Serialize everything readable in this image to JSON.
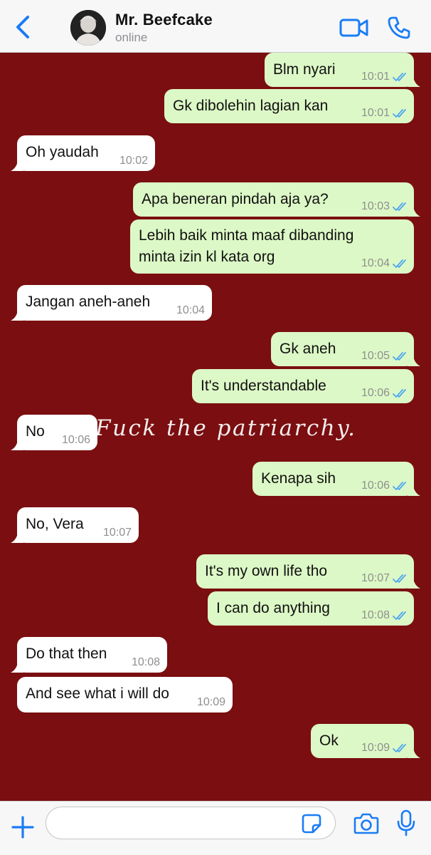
{
  "header": {
    "contact_name": "Mr. Beefcake",
    "status": "online"
  },
  "wallpaper_text": "Fuck the patriarchy.",
  "colors": {
    "accent": "#1a7cf5",
    "chat_background": "#7a0e10",
    "incoming_bubble": "#ffffff",
    "outgoing_bubble": "#dcf8c6",
    "read_ticks": "#4fa7f1"
  },
  "messages": [
    {
      "dir": "out",
      "text": "Blm nyari",
      "time": "10:01"
    },
    {
      "dir": "out",
      "text": "Gk dibolehin lagian kan",
      "time": "10:01"
    },
    {
      "dir": "in",
      "text": "Oh yaudah",
      "time": "10:02"
    },
    {
      "dir": "out",
      "text": "Apa beneran pindah aja ya?",
      "time": "10:03"
    },
    {
      "dir": "out",
      "text": "Lebih baik minta maaf dibanding minta izin kl kata org",
      "time": "10:04"
    },
    {
      "dir": "in",
      "text": "Jangan aneh-aneh",
      "time": "10:04"
    },
    {
      "dir": "out",
      "text": "Gk aneh",
      "time": "10:05"
    },
    {
      "dir": "out",
      "text": "It's understandable",
      "time": "10:06"
    },
    {
      "dir": "in",
      "text": "No",
      "time": "10:06"
    },
    {
      "dir": "out",
      "text": "Kenapa sih",
      "time": "10:06"
    },
    {
      "dir": "in",
      "text": "No, Vera",
      "time": "10:07"
    },
    {
      "dir": "out",
      "text": "It's my own life tho",
      "time": "10:07"
    },
    {
      "dir": "out",
      "text": "I can do anything",
      "time": "10:08"
    },
    {
      "dir": "in",
      "text": "Do that then",
      "time": "10:08"
    },
    {
      "dir": "in",
      "text": "And see what i will do",
      "time": "10:09"
    },
    {
      "dir": "out",
      "text": "Ok",
      "time": "10:09"
    }
  ],
  "input": {
    "placeholder": "",
    "value": ""
  },
  "icons": {
    "back": "chevron-left-icon",
    "video": "video-camera-icon",
    "call": "phone-icon",
    "plus": "plus-icon",
    "sticker": "sticker-icon",
    "camera": "camera-icon",
    "mic": "microphone-icon"
  }
}
